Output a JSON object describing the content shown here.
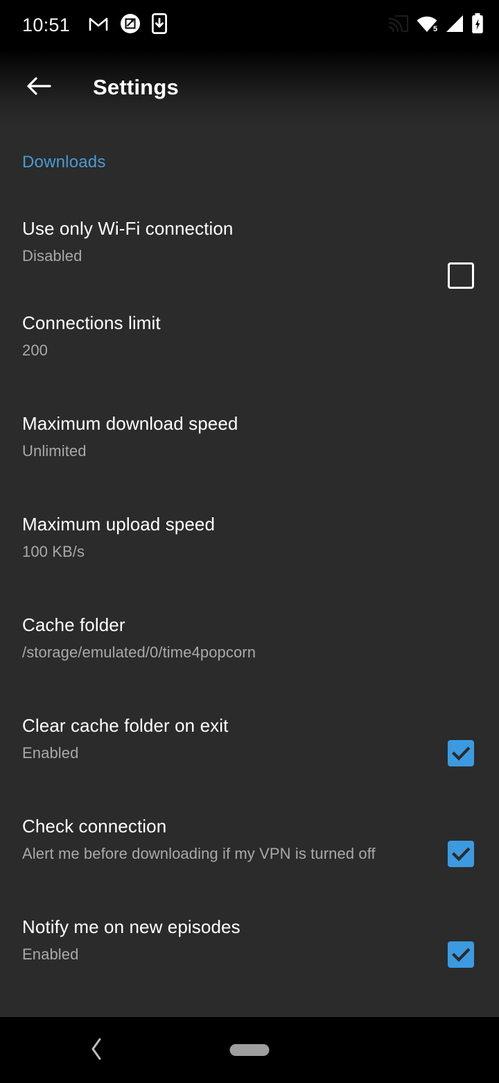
{
  "status_bar": {
    "time": "10:51",
    "left_icons": [
      "gmail-icon",
      "screenshot-markup-icon",
      "app-download-icon"
    ],
    "right_icons": [
      "cast-icon",
      "wifi-icon",
      "cellular-signal-icon",
      "battery-charging-icon"
    ],
    "wifi_label": "5"
  },
  "toolbar": {
    "title": "Settings",
    "back_icon": "arrow-left-icon"
  },
  "sections": [
    {
      "header": "Downloads",
      "items": [
        {
          "title": "Use only Wi-Fi connection",
          "summary": "Disabled",
          "control": "checkbox",
          "checked": false
        },
        {
          "title": "Connections limit",
          "summary": "200",
          "control": "none"
        },
        {
          "title": "Maximum download speed",
          "summary": "Unlimited",
          "control": "none"
        },
        {
          "title": "Maximum upload speed",
          "summary": "100 KB/s",
          "control": "none"
        },
        {
          "title": "Cache folder",
          "summary": "/storage/emulated/0/time4popcorn",
          "control": "none"
        },
        {
          "title": "Clear cache folder on exit",
          "summary": "Enabled",
          "control": "checkbox",
          "checked": true
        },
        {
          "title": "Check connection",
          "summary": "Alert me before downloading if my VPN is turned off",
          "control": "checkbox",
          "checked": true
        },
        {
          "title": "Notify me on new episodes",
          "summary": "Enabled",
          "control": "checkbox",
          "checked": true
        }
      ]
    }
  ],
  "navigation_bar": {
    "back_icon": "chevron-left-icon",
    "home_handle": "gesture-pill"
  },
  "colors": {
    "accent": "#3c9ae0",
    "section_header": "#4a9ad4",
    "background": "#2b2b2b",
    "title_text": "#ffffff",
    "summary_text": "#a9a9a9",
    "navbar_background": "#000000"
  }
}
